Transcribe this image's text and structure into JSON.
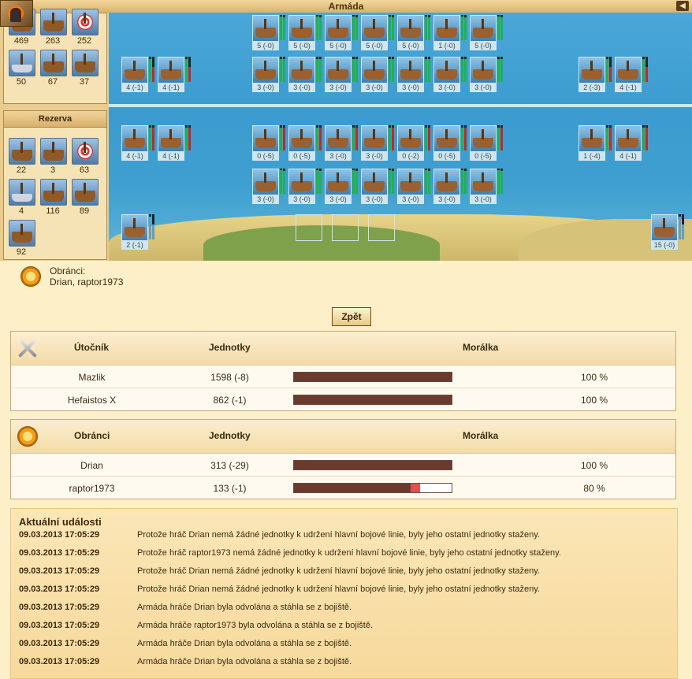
{
  "window": {
    "title": "Armáda",
    "back_icon": "back-icon"
  },
  "colors": {
    "sea": "#3c9ccf",
    "morale": "#6b3a2e",
    "morale_drop": "#e05050",
    "bar_green": "#22b14c",
    "bar_red": "#c0282d"
  },
  "left": {
    "top_counts": [
      "469",
      "263",
      "252",
      "50",
      "67",
      "37"
    ],
    "reserve": {
      "title": "Rezerva",
      "counts": [
        "22",
        "3",
        "63",
        "4",
        "116",
        "89",
        "92"
      ]
    }
  },
  "battle": {
    "upper_top": [
      "5 (-0)",
      "5 (-0)",
      "5 (-0)",
      "5 (-0)",
      "5 (-0)",
      "1 (-0)",
      "5 (-0)"
    ],
    "upper_left": [
      "4 (-1)",
      "4 (-1)"
    ],
    "upper_mid": [
      "3 (-0)",
      "3 (-0)",
      "3 (-0)",
      "3 (-0)",
      "3 (-0)",
      "3 (-0)",
      "3 (-0)"
    ],
    "upper_right": [
      "2 (-3)",
      "4 (-1)"
    ],
    "lower_left": [
      "4 (-1)",
      "4 (-1)"
    ],
    "lower_top": [
      "0 (-5)",
      "0 (-5)",
      "3 (-0)",
      "3 (-0)",
      "0 (-2)",
      "0 (-5)",
      "0 (-5)"
    ],
    "lower_right": [
      "1 (-4)",
      "4 (-1)"
    ],
    "lower_mid": [
      "3 (-0)",
      "3 (-0)",
      "3 (-0)",
      "3 (-0)",
      "3 (-0)",
      "3 (-0)",
      "3 (-0)"
    ],
    "shore_left": "2 (-1)",
    "shore_right": "15 (-0)"
  },
  "defenders_info": {
    "label": "Obránci:",
    "names": "Drian, raptor1973"
  },
  "back_button": "Zpět",
  "attackers_table": {
    "headers": {
      "role": "Útočník",
      "units": "Jednotky",
      "morale": "Morálka"
    },
    "rows": [
      {
        "name": "Mazlik",
        "units": "1598 (-8)",
        "morale": 1.0,
        "morale_text": "100 %"
      },
      {
        "name": "Hefaistos X",
        "units": "862 (-1)",
        "morale": 1.0,
        "morale_text": "100 %"
      }
    ]
  },
  "defenders_table": {
    "headers": {
      "role": "Obránci",
      "units": "Jednotky",
      "morale": "Morálka"
    },
    "rows": [
      {
        "name": "Drian",
        "units": "313 (-29)",
        "morale": 1.0,
        "morale_text": "100 %"
      },
      {
        "name": "raptor1973",
        "units": "133 (-1)",
        "morale": 0.8,
        "morale_text": "80 %"
      }
    ]
  },
  "events": {
    "title": "Aktuální události",
    "items": [
      {
        "time": "09.03.2013 17:05:29",
        "text": "Protože hráč Drian nemá žádné jednotky k udržení hlavní bojové linie, byly jeho ostatní jednotky staženy."
      },
      {
        "time": "09.03.2013 17:05:29",
        "text": "Protože hráč raptor1973 nemá žádné jednotky k udržení hlavní bojové linie, byly jeho ostatní jednotky staženy."
      },
      {
        "time": "09.03.2013 17:05:29",
        "text": "Protože hráč Drian nemá žádné jednotky k udržení hlavní bojové linie, byly jeho ostatní jednotky staženy."
      },
      {
        "time": "09.03.2013 17:05:29",
        "text": "Protože hráč Drian nemá žádné jednotky k udržení hlavní bojové linie, byly jeho ostatní jednotky staženy."
      },
      {
        "time": "09.03.2013 17:05:29",
        "text": "Armáda hráče Drian byla odvolána a stáhla se z bojiště."
      },
      {
        "time": "09.03.2013 17:05:29",
        "text": "Armáda hráče raptor1973 byla odvolána a stáhla se z bojiště."
      },
      {
        "time": "09.03.2013 17:05:29",
        "text": "Armáda hráče Drian byla odvolána a stáhla se z bojiště."
      },
      {
        "time": "09.03.2013 17:05:29",
        "text": "Armáda hráče Drian byla odvolána a stáhla se z bojiště."
      }
    ]
  }
}
